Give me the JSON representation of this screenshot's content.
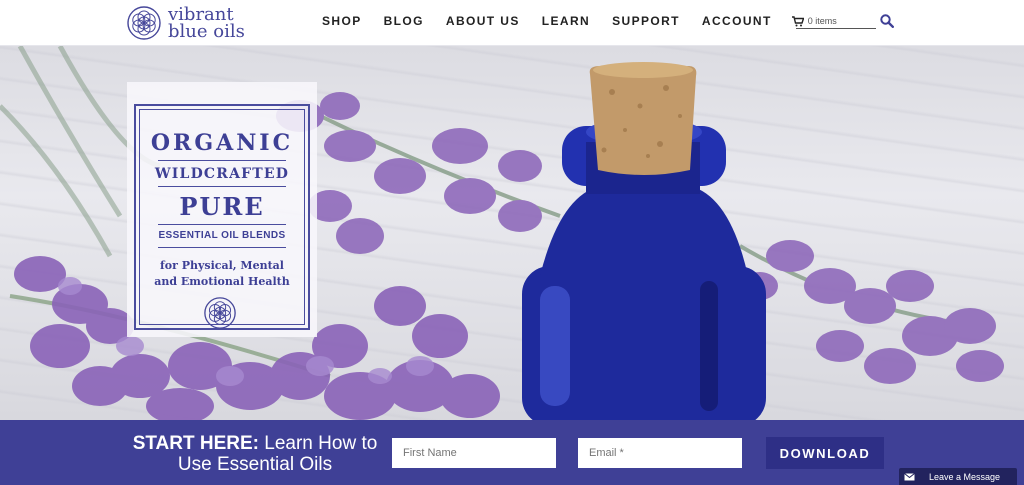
{
  "brand": {
    "line1": "vibrant",
    "line2": "blue oils"
  },
  "nav": {
    "items": [
      "SHOP",
      "BLOG",
      "ABOUT US",
      "LEARN",
      "SUPPORT",
      "ACCOUNT"
    ]
  },
  "cart": {
    "label": "0 items"
  },
  "search": {
    "placeholder": ""
  },
  "hero_card": {
    "line1": "ORGANIC",
    "line2": "WILDCRAFTED",
    "line3": "PURE",
    "line4": "ESSENTIAL OIL BLENDS",
    "line5a": "for Physical, Mental",
    "line5b": "and Emotional Health"
  },
  "signup": {
    "bold": "START HERE:",
    "text1": " Learn How to",
    "text2": "Use Essential Oils",
    "first_name_placeholder": "First Name",
    "email_placeholder": "Email *",
    "button": "DOWNLOAD"
  },
  "chat": {
    "label": "Leave a Message"
  },
  "colors": {
    "brand_blue": "#3f4096",
    "button_blue": "#2e2f86",
    "chat_bg": "#22235e",
    "lavender": "#8a63b8"
  },
  "icons": [
    "logo-flower-of-life-icon",
    "cart-icon",
    "search-icon",
    "envelope-icon"
  ]
}
